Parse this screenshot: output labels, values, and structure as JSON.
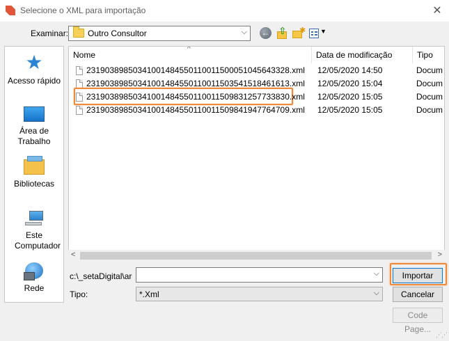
{
  "window": {
    "title": "Selecione o XML para importação",
    "close_glyph": "✕"
  },
  "toolbar": {
    "look_in_label": "Examinar:",
    "look_in_value": "Outro Consultor",
    "icons": [
      "back-icon",
      "up-folder-icon",
      "new-folder-icon",
      "view-menu-icon"
    ]
  },
  "places": [
    {
      "label": "Acesso rápido",
      "icon": "star-icon"
    },
    {
      "label": "Área de Trabalho",
      "icon": "desktop-icon"
    },
    {
      "label": "Bibliotecas",
      "icon": "libraries-icon"
    },
    {
      "label": "Este Computador",
      "icon": "computer-icon"
    },
    {
      "label": "Rede",
      "icon": "network-icon"
    }
  ],
  "file_list": {
    "columns": {
      "name": "Nome",
      "date": "Data de modificação",
      "type": "Tipo"
    },
    "rows": [
      {
        "name": "23190389850341001484550110011500051045643328.xml",
        "date": "12/05/2020 14:50",
        "type": "Docum",
        "highlighted": false
      },
      {
        "name": "23190389850341001484550110011503541518461613.xml",
        "date": "12/05/2020 15:04",
        "type": "Docum",
        "highlighted": false
      },
      {
        "name": "23190389850341001484550110011509831257733830.xml",
        "date": "12/05/2020 15:05",
        "type": "Docum",
        "highlighted": true
      },
      {
        "name": "23190389850341001484550110011509841947764709.xml",
        "date": "12/05/2020 15:05",
        "type": "Docum",
        "highlighted": false
      }
    ]
  },
  "form": {
    "path_label": "c:\\_setaDigital\\arq",
    "file_name_value": "",
    "type_label": "Tipo:",
    "type_value": "*.Xml"
  },
  "buttons": {
    "import": "Importar",
    "cancel": "Cancelar",
    "code_page": "Code Page..."
  },
  "colors": {
    "highlight_outline": "#ee8a3a",
    "primary_button_border": "#0078d7"
  }
}
